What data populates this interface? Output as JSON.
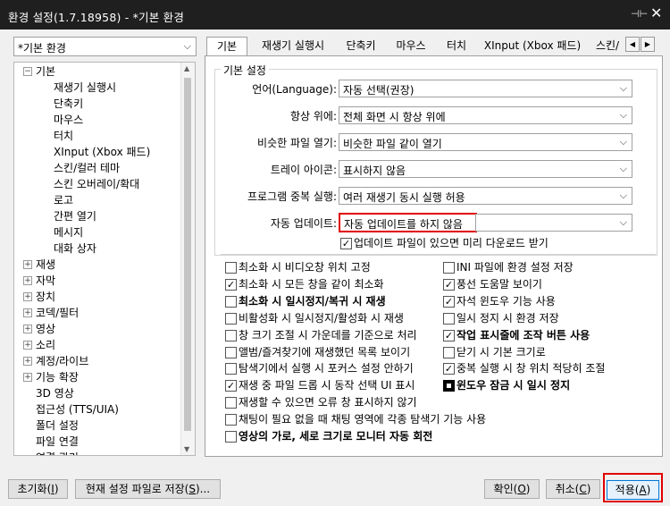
{
  "window": {
    "title": "환경 설정(1.7.18958) - *기본 환경",
    "pin_icon": "pin-icon",
    "close_icon": "close-icon"
  },
  "profile_select": {
    "value": "*기본 환경"
  },
  "tree": {
    "items": [
      {
        "label": "기본",
        "expander": "−"
      },
      {
        "label": "재생기 실행시"
      },
      {
        "label": "단축키"
      },
      {
        "label": "마우스"
      },
      {
        "label": "터치"
      },
      {
        "label": "XInput (Xbox 패드)"
      },
      {
        "label": "스킨/컬러 테마"
      },
      {
        "label": "스킨 오버레이/확대"
      },
      {
        "label": "로고"
      },
      {
        "label": "간편 열기"
      },
      {
        "label": "메시지"
      },
      {
        "label": "대화 상자"
      },
      {
        "label": "재생",
        "expander": "+"
      },
      {
        "label": "자막",
        "expander": "+"
      },
      {
        "label": "장치",
        "expander": "+"
      },
      {
        "label": "코덱/필터",
        "expander": "+"
      },
      {
        "label": "영상",
        "expander": "+"
      },
      {
        "label": "소리",
        "expander": "+"
      },
      {
        "label": "계정/라이브",
        "expander": "+"
      },
      {
        "label": "기능 확장",
        "expander": "+"
      },
      {
        "label": "3D 영상"
      },
      {
        "label": "접근성 (TTS/UIA)"
      },
      {
        "label": "폴더 설정"
      },
      {
        "label": "파일 연결"
      },
      {
        "label": "연결 관리"
      }
    ]
  },
  "tabs": [
    "기본",
    "재생기 실행시",
    "단축키",
    "마우스",
    "터치",
    "XInput (Xbox 패드)",
    "스킨/"
  ],
  "basic_settings": {
    "group_title": "기본 설정",
    "rows": [
      {
        "label": "언어(Language):",
        "value": "자동 선택(권장)"
      },
      {
        "label": "항상 위에:",
        "value": "전체 화면 시 항상 위에"
      },
      {
        "label": "비슷한 파일 열기:",
        "value": "비슷한 파일 같이 열기"
      },
      {
        "label": "트레이 아이콘:",
        "value": "표시하지 않음"
      },
      {
        "label": "프로그램 중복 실행:",
        "value": "여러 재생기 동시 실행 허용"
      },
      {
        "label": "자동 업데이트:",
        "value": "자동 업데이트를 하지 않음"
      }
    ],
    "predownload": {
      "label": "업데이트 파일이 있으면 미리 다운로드 받기",
      "checked": true
    }
  },
  "options_left": [
    {
      "label": "최소화 시 비디오창 위치 고정",
      "state": "unchecked"
    },
    {
      "label": "최소화 시 모든 창을 같이 최소화",
      "state": "checked"
    },
    {
      "label": "최소화 시 일시정지/복귀 시 재생",
      "state": "unchecked",
      "bold": true
    },
    {
      "label": "비활성화 시 일시정지/활성화 시 재생",
      "state": "unchecked"
    },
    {
      "label": "창 크기 조절 시 가운데를 기준으로 처리",
      "state": "unchecked"
    },
    {
      "label": "앨범/즐겨찾기에 재생했던 목록 보이기",
      "state": "unchecked"
    },
    {
      "label": "탐색기에서 실행 시 포커스 설정 안하기",
      "state": "unchecked"
    },
    {
      "label": "재생 중 파일 드롭 시 동작 선택 UI 표시",
      "state": "checked"
    },
    {
      "label": "재생할 수 있으면 오류 창 표시하지 않기",
      "state": "unchecked"
    },
    {
      "label": "채팅이 필요 없을 때 채팅 영역에 각종 탐색기 기능 사용",
      "state": "unchecked"
    },
    {
      "label": "영상의 가로, 세로 크기로 모니터 자동 회전",
      "state": "unchecked",
      "bold": true
    }
  ],
  "options_right": [
    {
      "label": "INI 파일에 환경 설정 저장",
      "state": "unchecked"
    },
    {
      "label": "풍선 도움말 보이기",
      "state": "checked"
    },
    {
      "label": "자석 윈도우 기능 사용",
      "state": "checked"
    },
    {
      "label": "일시 정지 시 환경 저장",
      "state": "unchecked"
    },
    {
      "label": "작업 표시줄에 조작 버튼 사용",
      "state": "checked",
      "bold": true
    },
    {
      "label": "닫기 시 기본 크기로",
      "state": "unchecked"
    },
    {
      "label": "중복 실행 시 창 위치 적당히 조절",
      "state": "checked"
    },
    {
      "label": "윈도우 잠금 시 일시 정지",
      "state": "indeterminate",
      "bold": true
    }
  ],
  "buttons": {
    "reset": {
      "text": "초기화(",
      "key": "I",
      ")": ")"
    },
    "save_current": {
      "text": "현재 설정 파일로 저장(",
      "key": "S",
      "tail": ")..."
    },
    "ok": {
      "text": "확인(",
      "key": "O",
      "tail": ")"
    },
    "cancel": {
      "text": "취소(",
      "key": "C",
      "tail": ")"
    },
    "apply": {
      "text": "적용(",
      "key": "A",
      "tail": ")"
    }
  },
  "colors": {
    "highlight": "#e00000",
    "titlebar": "#1f1f1f"
  }
}
